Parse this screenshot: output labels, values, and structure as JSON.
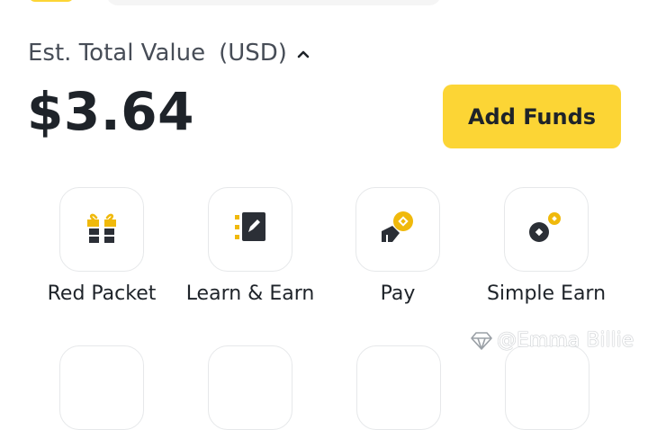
{
  "balance": {
    "label": "Est. Total Value",
    "currency": "(USD)",
    "amount": "$3.64"
  },
  "actions": {
    "add_funds": "Add Funds"
  },
  "shortcuts": [
    {
      "label": "Red Packet",
      "icon": "gift-icon"
    },
    {
      "label": "Learn & Earn",
      "icon": "notebook-edit-icon"
    },
    {
      "label": "Pay",
      "icon": "pay-icon"
    },
    {
      "label": "Simple Earn",
      "icon": "coins-icon"
    }
  ],
  "watermark": "@Emma Billie",
  "colors": {
    "brand_yellow": "#fcd535",
    "text_primary": "#1e2329",
    "text_secondary": "#474d57",
    "tile_border": "#e6e8ea"
  }
}
